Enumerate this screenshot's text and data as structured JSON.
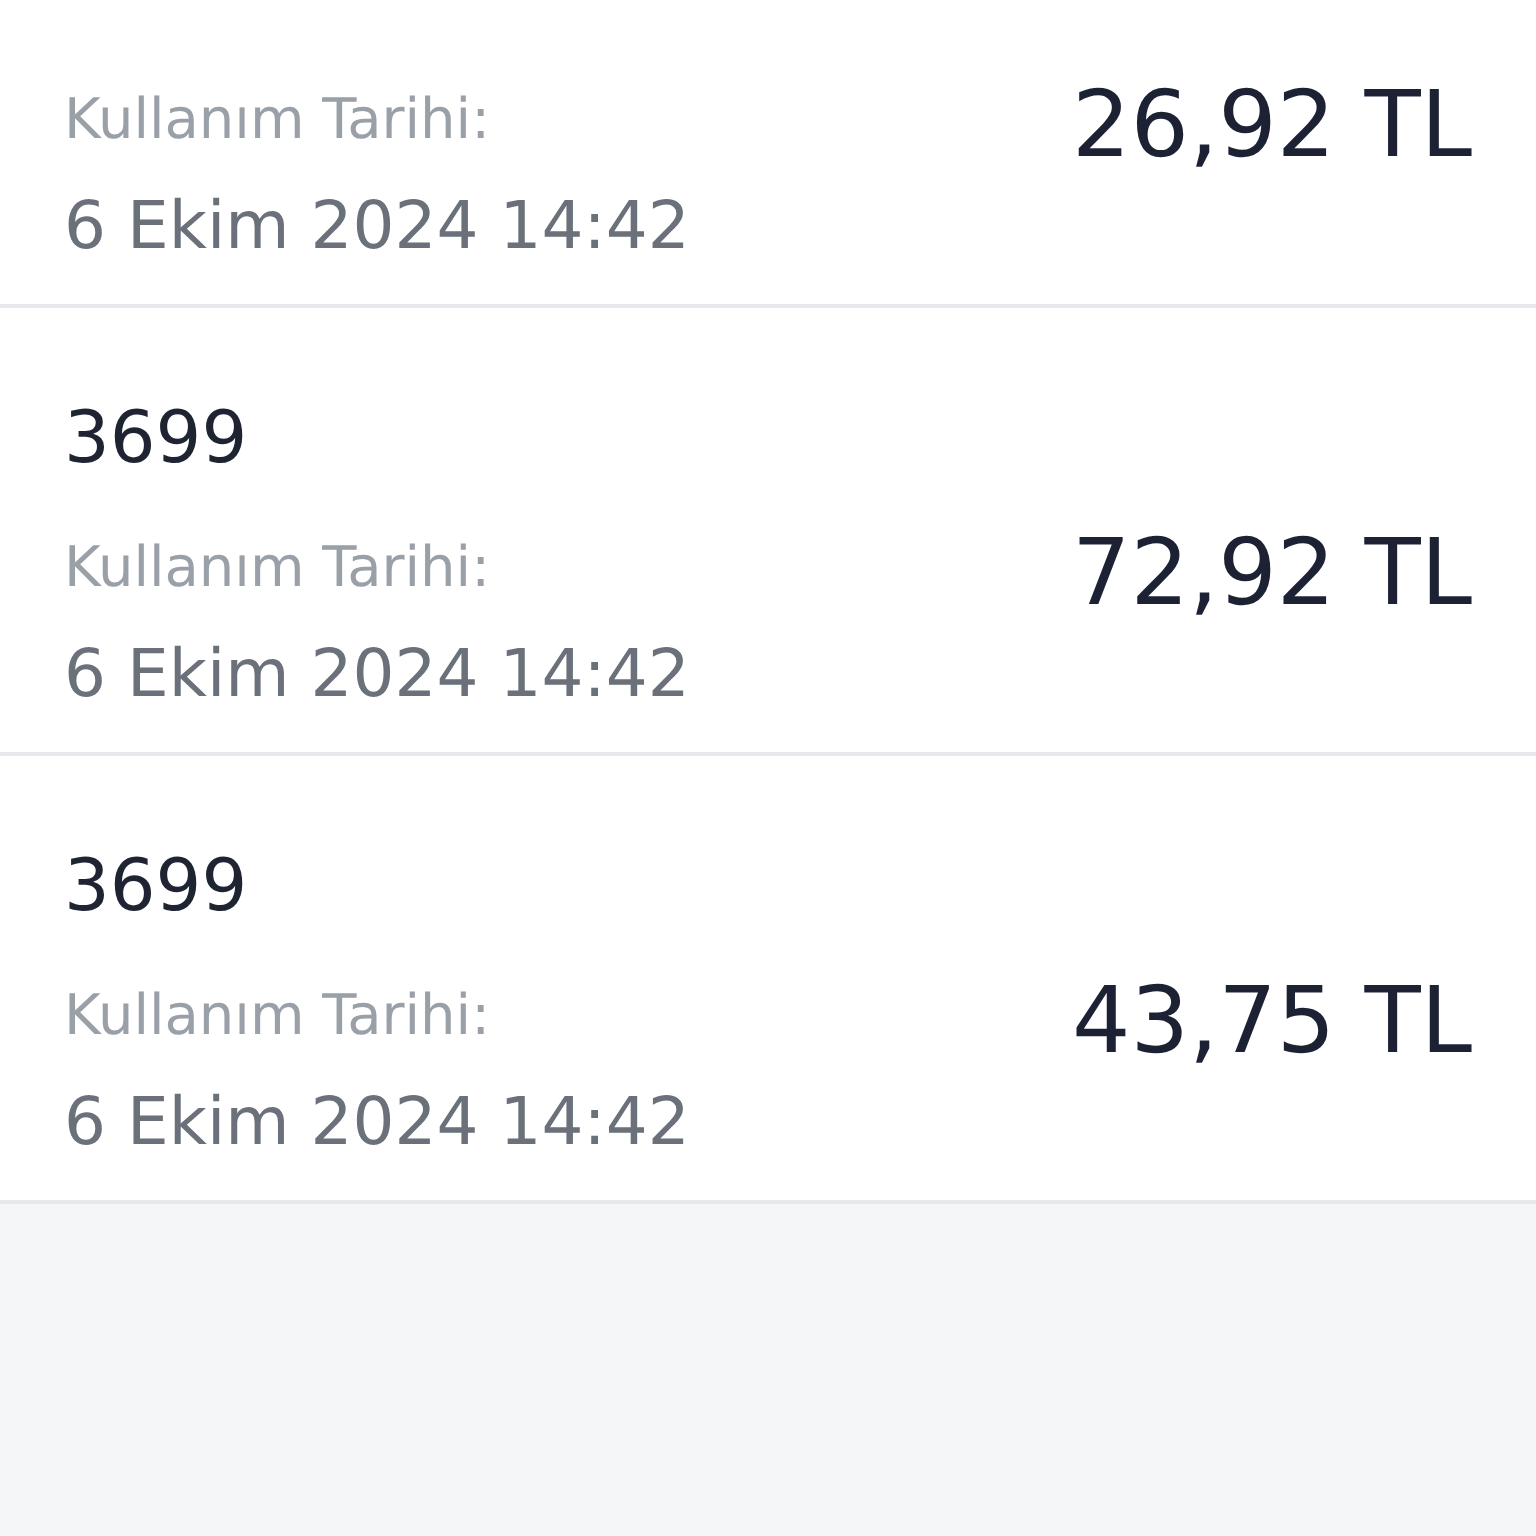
{
  "transactions": [
    {
      "label": "Kullanım Tarihi:",
      "date": "6 Ekim 2024 14:42",
      "amount": "26,92 TL"
    },
    {
      "title": "3699",
      "label": "Kullanım Tarihi:",
      "date": "6 Ekim 2024 14:42",
      "amount": "72,92 TL"
    },
    {
      "title": "3699",
      "label": "Kullanım Tarihi:",
      "date": "6 Ekim 2024 14:42",
      "amount": "43,75 TL"
    }
  ]
}
